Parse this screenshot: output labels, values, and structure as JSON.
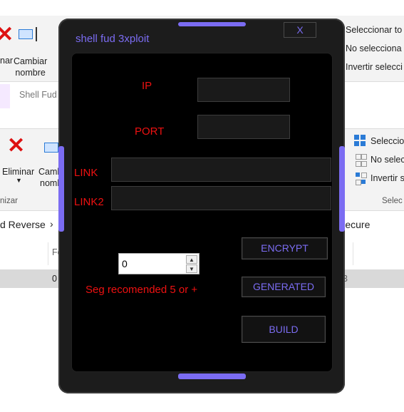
{
  "background": {
    "ribbon_top": {
      "left_partial": "nar",
      "rename": "Cambiar\nnombre",
      "select_all": "Seleccionar to",
      "select_none": "No selecciona",
      "invert_select": "Invertir selecci"
    },
    "tab_partial": "Shell Fud",
    "ribbon_mid": {
      "delete": "Eliminar",
      "rename_partial": "Cambi",
      "rename_partial2": "nomb",
      "select_all": "Seleccio",
      "select_none": "No selec",
      "invert_select": "Invertir s",
      "group_left": "nizar",
      "group_right": "Selec"
    },
    "address_left": "d Reverse",
    "address_chevron": "›",
    "address_right": "Secure",
    "column_header": "Fe",
    "row_left": "0",
    "row_right": "3"
  },
  "window": {
    "title": "shell fud 3xploit",
    "close_label": "X",
    "accent_color": "#7b6cf2",
    "label_color": "#ee1111"
  },
  "form": {
    "ip_label": "IP",
    "port_label": "PORT",
    "link_label": "LINK",
    "link2_label": "LINK2",
    "spinner_value": "0",
    "seg_text": "Seg recomended 5 or +",
    "encrypt_label": "ENCRYPT",
    "generated_label": "GENERATED",
    "build_label": "BUILD"
  }
}
